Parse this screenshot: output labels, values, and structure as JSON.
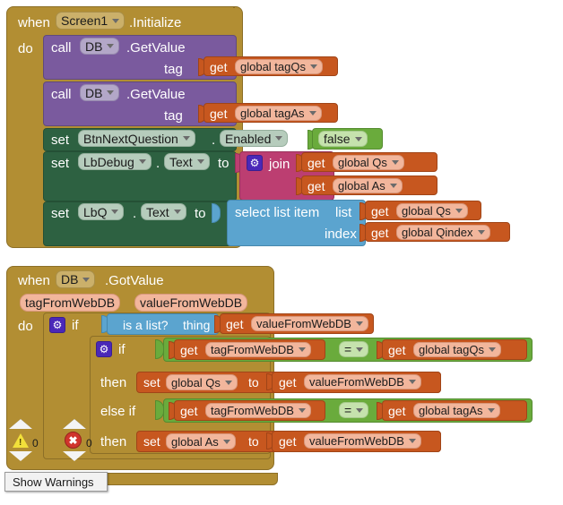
{
  "workspace": {
    "background": "#ffffff",
    "colors": {
      "event_gold": "#b28e33",
      "call_purple": "#7a5a9e",
      "setter_green": "#2d6141",
      "text_magenta": "#bc3e71",
      "list_blue": "#5ba4cf",
      "variable_orange": "#c7571f",
      "logic_green": "#6aab3c"
    }
  },
  "block1": {
    "when_label": "when",
    "component": "Screen1",
    "event": ".Initialize",
    "do_label": "do",
    "call1": {
      "call_label": "call",
      "component": "DB",
      "method": ".GetValue",
      "arg_label": "tag",
      "value": {
        "get_label": "get",
        "variable": "global tagQs"
      }
    },
    "call2": {
      "call_label": "call",
      "component": "DB",
      "method": ".GetValue",
      "arg_label": "tag",
      "value": {
        "get_label": "get",
        "variable": "global tagAs"
      }
    },
    "set1": {
      "set_label": "set",
      "component": "BtnNextQuestion",
      "dot": ".",
      "property": "Enabled",
      "to_label": "to",
      "value": "false"
    },
    "set2": {
      "set_label": "set",
      "component": "LbDebug",
      "dot": ".",
      "property": "Text",
      "to_label": "to",
      "join_label": "join",
      "join_items": [
        {
          "get_label": "get",
          "variable": "global Qs"
        },
        {
          "get_label": "get",
          "variable": "global As"
        }
      ]
    },
    "set3": {
      "set_label": "set",
      "component": "LbQ",
      "dot": ".",
      "property": "Text",
      "to_label": "to",
      "select_label": "select list item",
      "list_label": "list",
      "list_value": {
        "get_label": "get",
        "variable": "global Qs"
      },
      "index_label": "index",
      "index_value": {
        "get_label": "get",
        "variable": "global Qindex"
      }
    }
  },
  "block2": {
    "when_label": "when",
    "component": "DB",
    "event": ".GotValue",
    "params": [
      "tagFromWebDB",
      "valueFromWebDB"
    ],
    "do_label": "do",
    "outer_if": {
      "if_label": "if",
      "test": {
        "is_a_list_label": "is a list?",
        "thing_label": "thing",
        "value": {
          "get_label": "get",
          "variable": "valueFromWebDB"
        }
      },
      "inner_if": {
        "if_label": "if",
        "test1": {
          "left": {
            "get_label": "get",
            "variable": "tagFromWebDB"
          },
          "operator": "=",
          "right": {
            "get_label": "get",
            "variable": "global tagQs"
          }
        },
        "then_label": "then",
        "then1": {
          "set_label": "set",
          "variable": "global Qs",
          "to_label": "to",
          "value": {
            "get_label": "get",
            "variable": "valueFromWebDB"
          }
        },
        "else_if_label": "else if",
        "test2": {
          "left": {
            "get_label": "get",
            "variable": "tagFromWebDB"
          },
          "operator": "=",
          "right": {
            "get_label": "get",
            "variable": "global tagAs"
          }
        },
        "then2_label": "then",
        "then2": {
          "set_label": "set",
          "variable": "global As",
          "to_label": "to",
          "value": {
            "get_label": "get",
            "variable": "valueFromWebDB"
          }
        }
      }
    }
  },
  "status": {
    "warning_count": "0",
    "error_count": "0",
    "show_warnings_label": "Show Warnings"
  }
}
